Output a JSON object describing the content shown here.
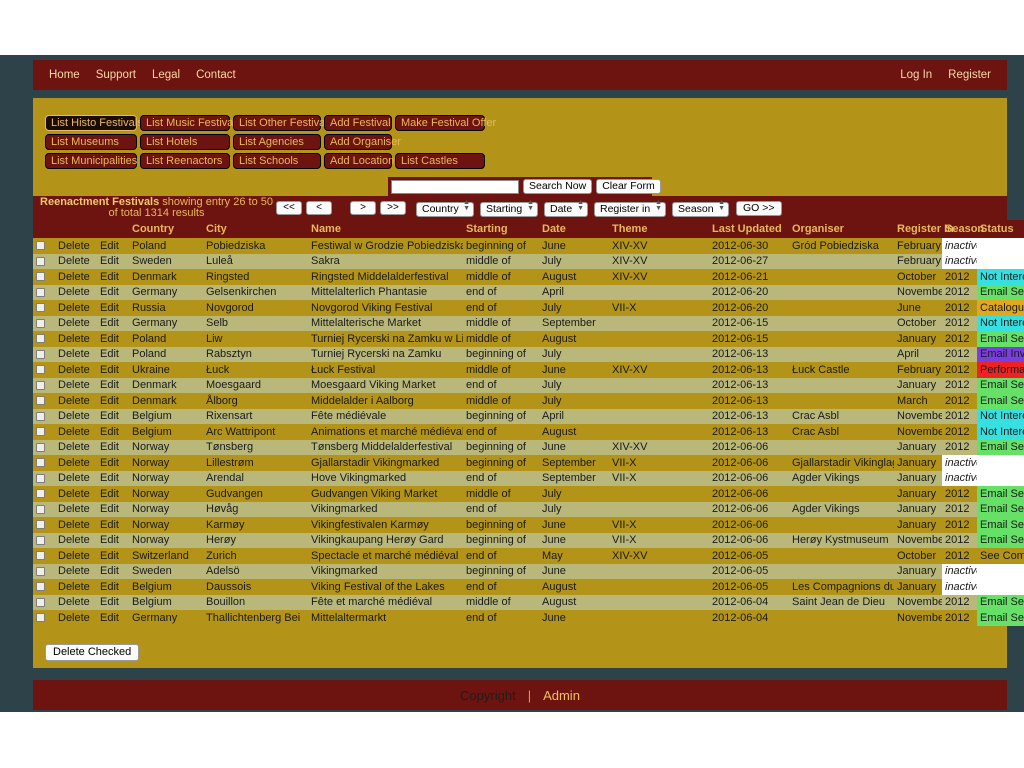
{
  "nav": {
    "left": [
      {
        "label": "Home",
        "name": "nav-home"
      },
      {
        "label": "Support",
        "name": "nav-support"
      },
      {
        "label": "Legal",
        "name": "nav-legal"
      },
      {
        "label": "Contact",
        "name": "nav-contact"
      }
    ],
    "right": [
      {
        "label": "Log In",
        "name": "nav-login"
      },
      {
        "label": "Register",
        "name": "nav-register"
      }
    ]
  },
  "menu_buttons": [
    [
      {
        "label": "List Histo Festivals",
        "active": true
      },
      {
        "label": "List Music Festivals",
        "active": false
      },
      {
        "label": "List Other Festivals",
        "active": false
      },
      {
        "label": "Add Festival",
        "active": false
      },
      {
        "label": "Make Festival Offer",
        "active": false
      }
    ],
    [
      {
        "label": "List Museums",
        "active": false
      },
      {
        "label": "List Hotels",
        "active": false
      },
      {
        "label": "List Agencies",
        "active": false
      },
      {
        "label": "Add Organiser",
        "active": false
      }
    ],
    [
      {
        "label": "List Municipalities",
        "active": false
      },
      {
        "label": "List Reenactors",
        "active": false
      },
      {
        "label": "List Schools",
        "active": false
      },
      {
        "label": "Add Location",
        "active": false
      },
      {
        "label": "List Castles",
        "active": false
      }
    ]
  ],
  "search": {
    "value": "",
    "placeholder": "",
    "search_now": "Search Now",
    "clear_form": "Clear Form"
  },
  "results": {
    "entity": "Reenactment Festivals",
    "summary": " showing entry 26 to 50 of total 1314 results"
  },
  "pager": {
    "first": "<<",
    "prev": "<",
    "next": ">",
    "last": ">>",
    "go": "GO >>"
  },
  "filters": [
    {
      "name": "country-filter",
      "value": "Country"
    },
    {
      "name": "starting-filter",
      "value": "Starting"
    },
    {
      "name": "date-filter",
      "value": "Date"
    },
    {
      "name": "register-in-filter",
      "value": "Register in"
    },
    {
      "name": "season-filter",
      "value": "Season"
    }
  ],
  "table": {
    "headers": [
      "",
      "",
      "",
      "Country",
      "City",
      "Name",
      "Starting",
      "Date",
      "Theme",
      "Last Updated",
      "Organiser",
      "Register In",
      "Season",
      "Status"
    ],
    "actions": {
      "delete": "Delete",
      "edit": "Edit"
    },
    "rows": [
      {
        "country": "Poland",
        "city": "Pobiedziska",
        "name": "Festiwal w Grodzie Pobiedziska",
        "starting": "beginning of",
        "date": "June",
        "theme": "XIV-XV",
        "updated": "2012-06-30",
        "organiser": "Gród Pobiedziska",
        "register": "February",
        "season": "inactive",
        "season_inactive": true,
        "status": "",
        "status_color": "#ffffff"
      },
      {
        "country": "Sweden",
        "city": "Luleå",
        "name": "Sakra",
        "starting": "middle of",
        "date": "July",
        "theme": "XIV-XV",
        "updated": "2012-06-27",
        "organiser": "",
        "register": "February",
        "season": "inactive",
        "season_inactive": true,
        "status": "",
        "status_color": "#ffffff"
      },
      {
        "country": "Denmark",
        "city": "Ringsted",
        "name": "Ringsted Middelalderfestival",
        "starting": "middle of",
        "date": "August",
        "theme": "XIV-XV",
        "updated": "2012-06-21",
        "organiser": "",
        "register": "October",
        "season": "2012",
        "season_inactive": false,
        "status": "Not Interested",
        "status_color": "#36e0e0"
      },
      {
        "country": "Germany",
        "city": "Gelsenkirchen",
        "name": "Mittelalterlich Phantasie",
        "starting": "end of",
        "date": "April",
        "theme": "",
        "updated": "2012-06-20",
        "organiser": "",
        "register": "November",
        "season": "2012",
        "season_inactive": false,
        "status": "Email Sent",
        "status_color": "#66e066"
      },
      {
        "country": "Russia",
        "city": "Novgorod",
        "name": "Novgorod Viking Festival",
        "starting": "end of",
        "date": "July",
        "theme": "VII-X",
        "updated": "2012-06-20",
        "organiser": "",
        "register": "June",
        "season": "2012",
        "season_inactive": false,
        "status": "Catalogue Sent",
        "status_color": "#e0a81e"
      },
      {
        "country": "Germany",
        "city": "Selb",
        "name": "Mittelalterische Market",
        "starting": "middle of",
        "date": "September",
        "theme": "",
        "updated": "2012-06-15",
        "organiser": "",
        "register": "October",
        "season": "2012",
        "season_inactive": false,
        "status": "Not Interested",
        "status_color": "#36e0e0"
      },
      {
        "country": "Poland",
        "city": "Liw",
        "name": "Turniej Rycerski na Zamku w Liwie",
        "starting": "middle of",
        "date": "August",
        "theme": "",
        "updated": "2012-06-15",
        "organiser": "",
        "register": "January",
        "season": "2012",
        "season_inactive": false,
        "status": "Email Sent",
        "status_color": "#66e066"
      },
      {
        "country": "Poland",
        "city": "Rabsztyn",
        "name": "Turniej Rycerski na Zamku",
        "starting": "beginning of",
        "date": "July",
        "theme": "",
        "updated": "2012-06-13",
        "organiser": "",
        "register": "April",
        "season": "2012",
        "season_inactive": false,
        "status": "Email Invalid",
        "status_color": "#7a3de0"
      },
      {
        "country": "Ukraine",
        "city": "Łuck",
        "name": "Łuck Festival",
        "starting": "middle of",
        "date": "June",
        "theme": "XIV-XV",
        "updated": "2012-06-13",
        "organiser": "Łuck Castle",
        "register": "February",
        "season": "2012",
        "season_inactive": false,
        "status": "Performance",
        "status_color": "#ee2222"
      },
      {
        "country": "Denmark",
        "city": "Moesgaard",
        "name": "Moesgaard Viking Market",
        "starting": "end of",
        "date": "July",
        "theme": "",
        "updated": "2012-06-13",
        "organiser": "",
        "register": "January",
        "season": "2012",
        "season_inactive": false,
        "status": "Email Sent",
        "status_color": "#66e066"
      },
      {
        "country": "Denmark",
        "city": "Ålborg",
        "name": "Middelalder i Aalborg",
        "starting": "middle of",
        "date": "July",
        "theme": "",
        "updated": "2012-06-13",
        "organiser": "",
        "register": "March",
        "season": "2012",
        "season_inactive": false,
        "status": "Email Sent",
        "status_color": "#66e066"
      },
      {
        "country": "Belgium",
        "city": "Rixensart",
        "name": "Fête médiévale",
        "starting": "beginning of",
        "date": "April",
        "theme": "",
        "updated": "2012-06-13",
        "organiser": "Crac Asbl",
        "register": "November",
        "season": "2012",
        "season_inactive": false,
        "status": "Not Interested",
        "status_color": "#36e0e0"
      },
      {
        "country": "Belgium",
        "city": "Arc Wattripont",
        "name": "Animations et marché médiéval",
        "starting": "end of",
        "date": "August",
        "theme": "",
        "updated": "2012-06-13",
        "organiser": "Crac Asbl",
        "register": "November",
        "season": "2012",
        "season_inactive": false,
        "status": "Not Interested",
        "status_color": "#36e0e0"
      },
      {
        "country": "Norway",
        "city": "Tønsberg",
        "name": "Tønsberg Middelalderfestival",
        "starting": "beginning of",
        "date": "June",
        "theme": "XIV-XV",
        "updated": "2012-06-06",
        "organiser": "",
        "register": "January",
        "season": "2012",
        "season_inactive": false,
        "status": "Email Sent",
        "status_color": "#66e066"
      },
      {
        "country": "Norway",
        "city": "Lillestrøm",
        "name": "Gjallarstadir Vikingmarked",
        "starting": "beginning of",
        "date": "September",
        "theme": "VII-X",
        "updated": "2012-06-06",
        "organiser": "Gjallarstadir Vikinglag",
        "register": "January",
        "season": "inactive",
        "season_inactive": true,
        "status": "",
        "status_color": "#ffffff"
      },
      {
        "country": "Norway",
        "city": "Arendal",
        "name": "Hove Vikingmarked",
        "starting": "end of",
        "date": "September",
        "theme": "VII-X",
        "updated": "2012-06-06",
        "organiser": "Agder Vikings",
        "register": "January",
        "season": "inactive",
        "season_inactive": true,
        "status": "",
        "status_color": "#ffffff"
      },
      {
        "country": "Norway",
        "city": "Gudvangen",
        "name": "Gudvangen Viking Market",
        "starting": "middle of",
        "date": "July",
        "theme": "",
        "updated": "2012-06-06",
        "organiser": "",
        "register": "January",
        "season": "2012",
        "season_inactive": false,
        "status": "Email Sent",
        "status_color": "#66e066"
      },
      {
        "country": "Norway",
        "city": "Høvåg",
        "name": "Vikingmarked",
        "starting": "end of",
        "date": "July",
        "theme": "",
        "updated": "2012-06-06",
        "organiser": "Agder Vikings",
        "register": "January",
        "season": "2012",
        "season_inactive": false,
        "status": "Email Sent",
        "status_color": "#66e066"
      },
      {
        "country": "Norway",
        "city": "Karmøy",
        "name": "Vikingfestivalen Karmøy",
        "starting": "beginning of",
        "date": "June",
        "theme": "VII-X",
        "updated": "2012-06-06",
        "organiser": "",
        "register": "January",
        "season": "2012",
        "season_inactive": false,
        "status": "Email Sent",
        "status_color": "#66e066"
      },
      {
        "country": "Norway",
        "city": "Herøy",
        "name": "Vikingkaupang Herøy Gard",
        "starting": "beginning of",
        "date": "June",
        "theme": "VII-X",
        "updated": "2012-06-06",
        "organiser": "Herøy Kystmuseum",
        "register": "November",
        "season": "2012",
        "season_inactive": false,
        "status": "Email Sent",
        "status_color": "#66e066"
      },
      {
        "country": "Switzerland",
        "city": "Zurich",
        "name": "Spectacle et marché médiéval",
        "starting": "end of",
        "date": "May",
        "theme": "XIV-XV",
        "updated": "2012-06-05",
        "organiser": "",
        "register": "October",
        "season": "2012",
        "season_inactive": false,
        "status": "See Comments",
        "status_color": "#b39419"
      },
      {
        "country": "Sweden",
        "city": "Adelsö",
        "name": "Vikingmarked",
        "starting": "beginning of",
        "date": "June",
        "theme": "",
        "updated": "2012-06-05",
        "organiser": "",
        "register": "January",
        "season": "inactive",
        "season_inactive": true,
        "status": "",
        "status_color": "#ffffff"
      },
      {
        "country": "Belgium",
        "city": "Daussois",
        "name": "Viking Festival of the Lakes",
        "starting": "end of",
        "date": "August",
        "theme": "",
        "updated": "2012-06-05",
        "organiser": "Les Compagnions du Cerf",
        "register": "January",
        "season": "inactive",
        "season_inactive": true,
        "status": "",
        "status_color": "#ffffff"
      },
      {
        "country": "Belgium",
        "city": "Bouillon",
        "name": "Fête et marché médiéval",
        "starting": "middle of",
        "date": "August",
        "theme": "",
        "updated": "2012-06-04",
        "organiser": "Saint Jean de Dieu",
        "register": "November",
        "season": "2012",
        "season_inactive": false,
        "status": "Email Sent",
        "status_color": "#66e066"
      },
      {
        "country": "Germany",
        "city": "Thallichtenberg Bei",
        "name": "Mittelaltermarkt",
        "starting": "end of",
        "date": "June",
        "theme": "",
        "updated": "2012-06-04",
        "organiser": "",
        "register": "November",
        "season": "2012",
        "season_inactive": false,
        "status": "Email Sent",
        "status_color": "#66e066"
      }
    ]
  },
  "delete_checked": "Delete Checked",
  "footer": {
    "copyright": "Copyright",
    "separator": "|",
    "admin": "Admin"
  }
}
